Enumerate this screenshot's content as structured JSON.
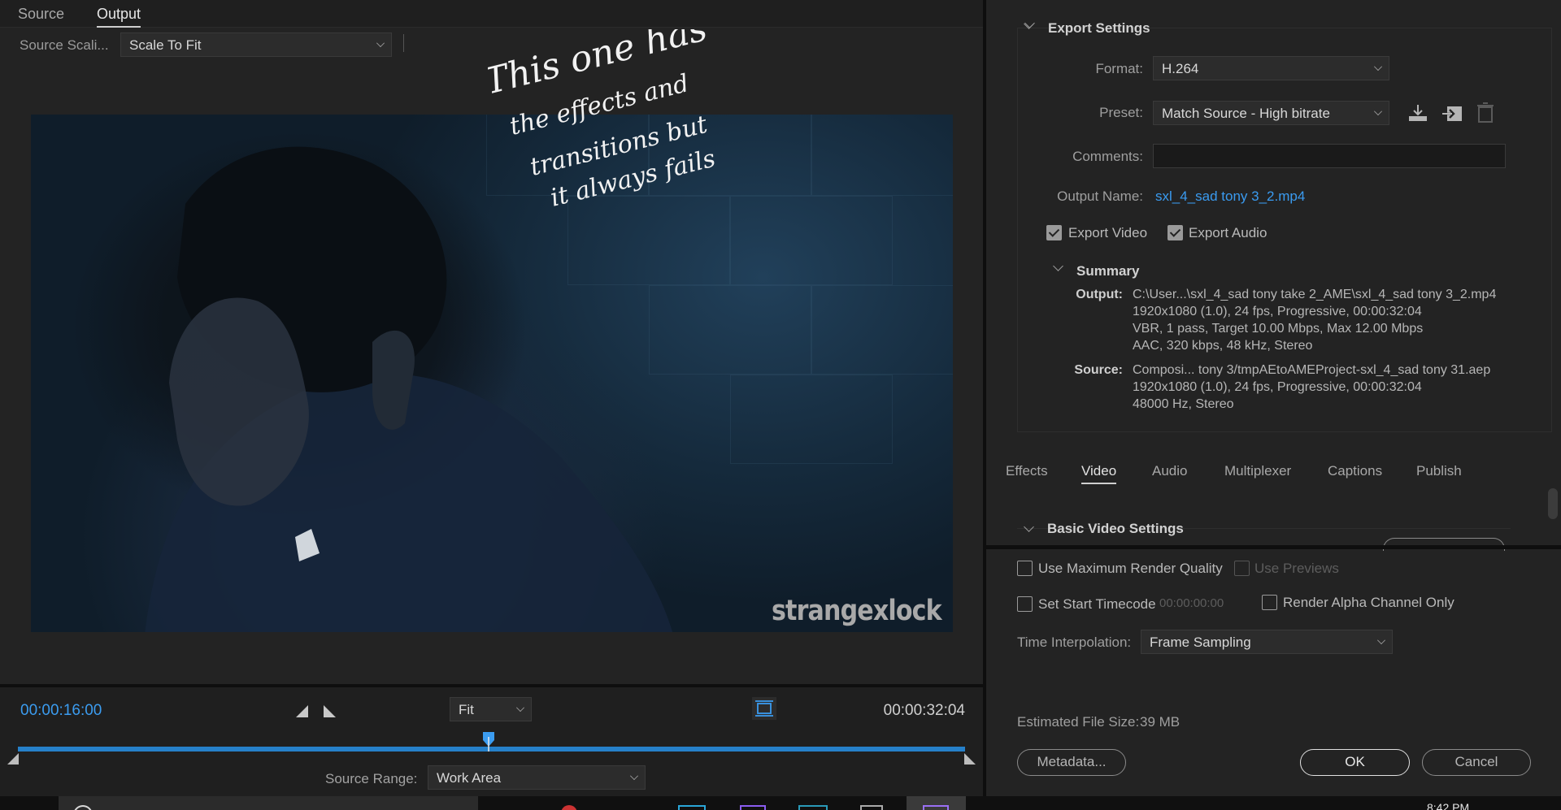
{
  "left_panel": {
    "tabs": [
      "Source",
      "Output"
    ],
    "active_tab": "Output",
    "source_scaling_label": "Source Scali...",
    "source_scaling_value": "Scale To Fit",
    "annotation": [
      "This one has",
      "the effects and",
      "transitions but",
      "it always fails"
    ],
    "watermark": "strangexlock"
  },
  "timeline": {
    "current_timecode": "00:00:16:00",
    "end_timecode": "00:00:32:04",
    "zoom_value": "Fit",
    "source_range_label": "Source Range:",
    "source_range_value": "Work Area"
  },
  "export_settings": {
    "title": "Export Settings",
    "format_label": "Format:",
    "format_value": "H.264",
    "preset_label": "Preset:",
    "preset_value": "Match Source - High bitrate",
    "comments_label": "Comments:",
    "comments_value": "",
    "output_name_label": "Output Name:",
    "output_name_value": "sxl_4_sad tony 3_2.mp4",
    "export_video_label": "Export Video",
    "export_audio_label": "Export Audio",
    "summary": {
      "title": "Summary",
      "output_key": "Output:",
      "output_lines": [
        "C:\\User...\\sxl_4_sad tony take 2_AME\\sxl_4_sad tony 3_2.mp4",
        "1920x1080 (1.0), 24 fps, Progressive, 00:00:32:04",
        "VBR, 1 pass, Target 10.00 Mbps, Max 12.00 Mbps",
        "AAC, 320 kbps, 48 kHz, Stereo"
      ],
      "source_key": "Source:",
      "source_lines": [
        "Composi... tony 3/tmpAEtoAMEProject-sxl_4_sad tony 31.aep",
        "1920x1080 (1.0), 24 fps, Progressive, 00:00:32:04",
        "48000 Hz, Stereo"
      ]
    }
  },
  "settings_tabs": [
    "Effects",
    "Video",
    "Audio",
    "Multiplexer",
    "Captions",
    "Publish"
  ],
  "active_settings_tab": "Video",
  "basic_video_settings_title": "Basic Video Settings",
  "options": {
    "max_render_quality": "Use Maximum Render Quality",
    "use_previews": "Use Previews",
    "set_start_timecode": "Set Start Timecode",
    "start_timecode_value": "00:00:00:00",
    "render_alpha": "Render Alpha Channel Only",
    "time_interp_label": "Time Interpolation:",
    "time_interp_value": "Frame Sampling",
    "est_size_label": "Estimated File Size:",
    "est_size_value": "39 MB"
  },
  "buttons": {
    "metadata": "Metadata...",
    "ok": "OK",
    "cancel": "Cancel"
  },
  "taskbar": {
    "clock": "8:42 PM"
  }
}
